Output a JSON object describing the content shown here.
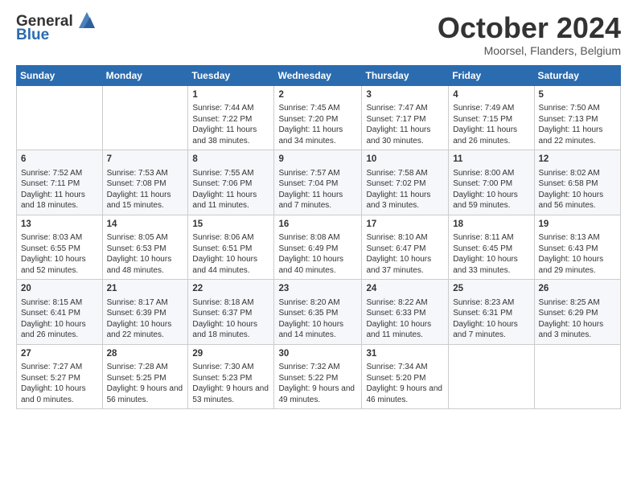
{
  "logo": {
    "line1": "General",
    "line2": "Blue"
  },
  "title": "October 2024",
  "location": "Moorsel, Flanders, Belgium",
  "weekdays": [
    "Sunday",
    "Monday",
    "Tuesday",
    "Wednesday",
    "Thursday",
    "Friday",
    "Saturday"
  ],
  "weeks": [
    [
      {
        "day": "",
        "info": ""
      },
      {
        "day": "",
        "info": ""
      },
      {
        "day": "1",
        "info": "Sunrise: 7:44 AM\nSunset: 7:22 PM\nDaylight: 11 hours and 38 minutes."
      },
      {
        "day": "2",
        "info": "Sunrise: 7:45 AM\nSunset: 7:20 PM\nDaylight: 11 hours and 34 minutes."
      },
      {
        "day": "3",
        "info": "Sunrise: 7:47 AM\nSunset: 7:17 PM\nDaylight: 11 hours and 30 minutes."
      },
      {
        "day": "4",
        "info": "Sunrise: 7:49 AM\nSunset: 7:15 PM\nDaylight: 11 hours and 26 minutes."
      },
      {
        "day": "5",
        "info": "Sunrise: 7:50 AM\nSunset: 7:13 PM\nDaylight: 11 hours and 22 minutes."
      }
    ],
    [
      {
        "day": "6",
        "info": "Sunrise: 7:52 AM\nSunset: 7:11 PM\nDaylight: 11 hours and 18 minutes."
      },
      {
        "day": "7",
        "info": "Sunrise: 7:53 AM\nSunset: 7:08 PM\nDaylight: 11 hours and 15 minutes."
      },
      {
        "day": "8",
        "info": "Sunrise: 7:55 AM\nSunset: 7:06 PM\nDaylight: 11 hours and 11 minutes."
      },
      {
        "day": "9",
        "info": "Sunrise: 7:57 AM\nSunset: 7:04 PM\nDaylight: 11 hours and 7 minutes."
      },
      {
        "day": "10",
        "info": "Sunrise: 7:58 AM\nSunset: 7:02 PM\nDaylight: 11 hours and 3 minutes."
      },
      {
        "day": "11",
        "info": "Sunrise: 8:00 AM\nSunset: 7:00 PM\nDaylight: 10 hours and 59 minutes."
      },
      {
        "day": "12",
        "info": "Sunrise: 8:02 AM\nSunset: 6:58 PM\nDaylight: 10 hours and 56 minutes."
      }
    ],
    [
      {
        "day": "13",
        "info": "Sunrise: 8:03 AM\nSunset: 6:55 PM\nDaylight: 10 hours and 52 minutes."
      },
      {
        "day": "14",
        "info": "Sunrise: 8:05 AM\nSunset: 6:53 PM\nDaylight: 10 hours and 48 minutes."
      },
      {
        "day": "15",
        "info": "Sunrise: 8:06 AM\nSunset: 6:51 PM\nDaylight: 10 hours and 44 minutes."
      },
      {
        "day": "16",
        "info": "Sunrise: 8:08 AM\nSunset: 6:49 PM\nDaylight: 10 hours and 40 minutes."
      },
      {
        "day": "17",
        "info": "Sunrise: 8:10 AM\nSunset: 6:47 PM\nDaylight: 10 hours and 37 minutes."
      },
      {
        "day": "18",
        "info": "Sunrise: 8:11 AM\nSunset: 6:45 PM\nDaylight: 10 hours and 33 minutes."
      },
      {
        "day": "19",
        "info": "Sunrise: 8:13 AM\nSunset: 6:43 PM\nDaylight: 10 hours and 29 minutes."
      }
    ],
    [
      {
        "day": "20",
        "info": "Sunrise: 8:15 AM\nSunset: 6:41 PM\nDaylight: 10 hours and 26 minutes."
      },
      {
        "day": "21",
        "info": "Sunrise: 8:17 AM\nSunset: 6:39 PM\nDaylight: 10 hours and 22 minutes."
      },
      {
        "day": "22",
        "info": "Sunrise: 8:18 AM\nSunset: 6:37 PM\nDaylight: 10 hours and 18 minutes."
      },
      {
        "day": "23",
        "info": "Sunrise: 8:20 AM\nSunset: 6:35 PM\nDaylight: 10 hours and 14 minutes."
      },
      {
        "day": "24",
        "info": "Sunrise: 8:22 AM\nSunset: 6:33 PM\nDaylight: 10 hours and 11 minutes."
      },
      {
        "day": "25",
        "info": "Sunrise: 8:23 AM\nSunset: 6:31 PM\nDaylight: 10 hours and 7 minutes."
      },
      {
        "day": "26",
        "info": "Sunrise: 8:25 AM\nSunset: 6:29 PM\nDaylight: 10 hours and 3 minutes."
      }
    ],
    [
      {
        "day": "27",
        "info": "Sunrise: 7:27 AM\nSunset: 5:27 PM\nDaylight: 10 hours and 0 minutes."
      },
      {
        "day": "28",
        "info": "Sunrise: 7:28 AM\nSunset: 5:25 PM\nDaylight: 9 hours and 56 minutes."
      },
      {
        "day": "29",
        "info": "Sunrise: 7:30 AM\nSunset: 5:23 PM\nDaylight: 9 hours and 53 minutes."
      },
      {
        "day": "30",
        "info": "Sunrise: 7:32 AM\nSunset: 5:22 PM\nDaylight: 9 hours and 49 minutes."
      },
      {
        "day": "31",
        "info": "Sunrise: 7:34 AM\nSunset: 5:20 PM\nDaylight: 9 hours and 46 minutes."
      },
      {
        "day": "",
        "info": ""
      },
      {
        "day": "",
        "info": ""
      }
    ]
  ]
}
